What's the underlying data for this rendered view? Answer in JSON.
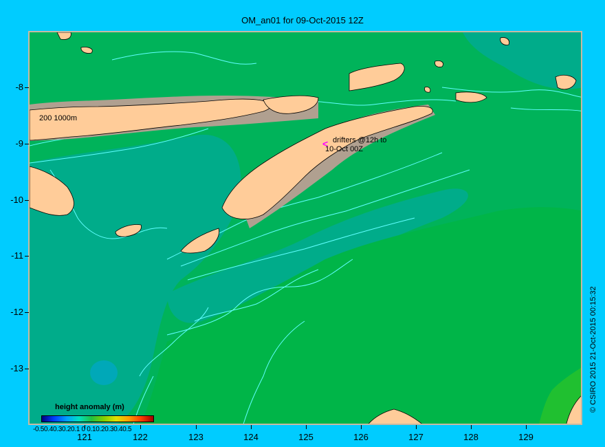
{
  "title": "OM_an01 for 09-Oct-2015 12Z",
  "y_axis_labels": [
    "-8",
    "-9",
    "-10",
    "-11",
    "-12",
    "-13"
  ],
  "x_axis_labels": [
    "121",
    "122",
    "123",
    "124",
    "125",
    "126",
    "127",
    "128",
    "129"
  ],
  "contour_label": "200  1000m",
  "annotation": {
    "line1": "drifters @12h to",
    "line2": "10-Oct 00Z",
    "marker": "<"
  },
  "legend": {
    "title": "height anomaly (m)",
    "ticks": "-0.50.40.30.20.1  0  0.10.20.30.40.5"
  },
  "credit": "© CSIRO 2015    21-Oct-2015 00:15:32",
  "colors": {
    "background": "#00ccff",
    "sea_main": "#00b35a",
    "sea_low": "#00a8a0",
    "land": "#ffcc99",
    "shelf": "#b0a090",
    "contour": "#60ffff",
    "drifter_marker": "#ff00ff",
    "frame": "#c9b9a2"
  }
}
